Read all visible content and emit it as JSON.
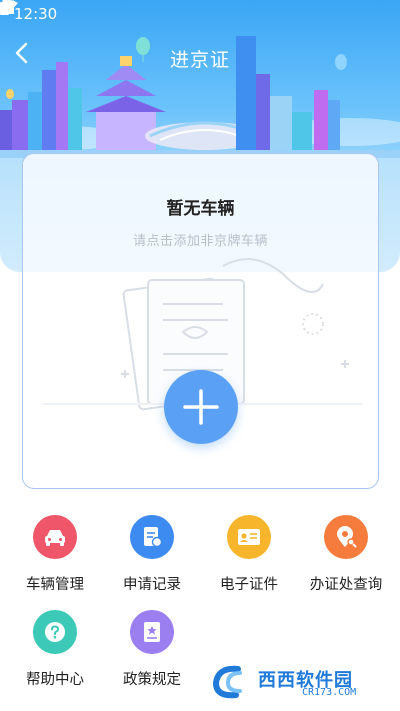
{
  "status_bar": {
    "time": "12:30"
  },
  "header": {
    "title": "进京证"
  },
  "card": {
    "empty_title": "暂无车辆",
    "empty_subtitle": "请点击添加非京牌车辆"
  },
  "grid": {
    "items": [
      {
        "label": "车辆管理",
        "icon": "car-icon",
        "color": "#f0566a"
      },
      {
        "label": "申请记录",
        "icon": "document-icon",
        "color": "#3d8bf0"
      },
      {
        "label": "电子证件",
        "icon": "id-card-icon",
        "color": "#f7b52c"
      },
      {
        "label": "办证处查询",
        "icon": "location-search-icon",
        "color": "#f57c3d"
      },
      {
        "label": "帮助中心",
        "icon": "help-icon",
        "color": "#3cc9b8"
      },
      {
        "label": "政策规定",
        "icon": "policy-book-icon",
        "color": "#9b7ff0"
      }
    ]
  },
  "watermark": {
    "brand": "西西软件园",
    "domain": "CR173.COM"
  },
  "colors": {
    "accent": "#5aa0f5",
    "card_border": "#a9c6f0"
  }
}
